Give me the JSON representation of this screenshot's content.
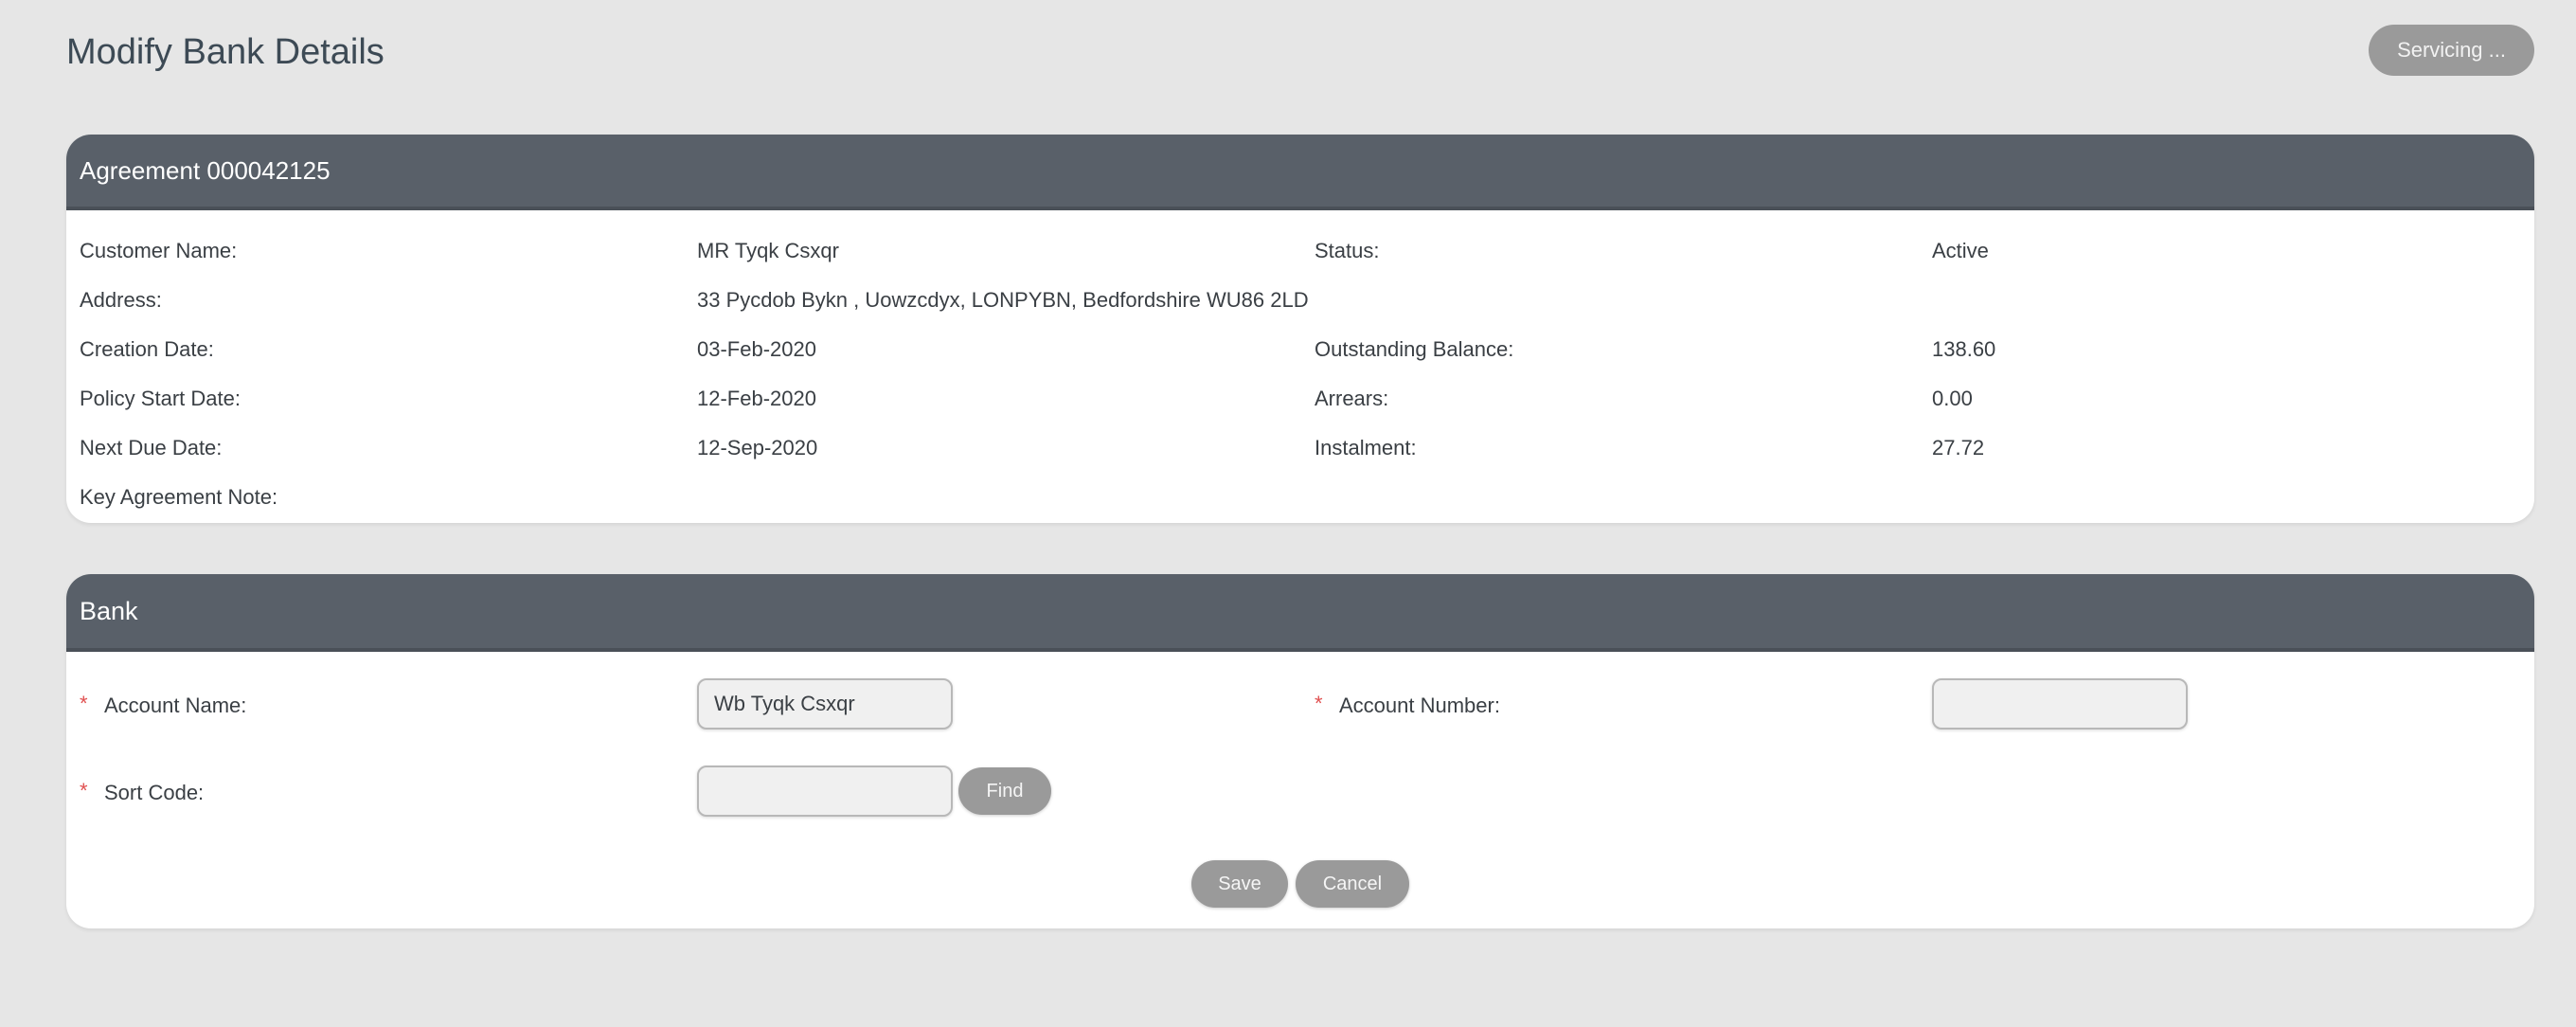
{
  "page": {
    "title": "Modify Bank Details",
    "servicing_label": "Servicing ..."
  },
  "agreement": {
    "header": "Agreement 000042125",
    "rows": [
      {
        "label1": "Customer Name:",
        "value1": "MR Tyqk Csxqr",
        "label2": "Status:",
        "value2": "Active"
      },
      {
        "label1": "Address:",
        "value1": "33 Pycdob Bykn , Uowzcdyx, LONPYBN, Bedfordshire WU86 2LD",
        "label2": "",
        "value2": ""
      },
      {
        "label1": "Creation Date:",
        "value1": "03-Feb-2020",
        "label2": "Outstanding Balance:",
        "value2": "138.60"
      },
      {
        "label1": "Policy Start Date:",
        "value1": "12-Feb-2020",
        "label2": "Arrears:",
        "value2": "0.00"
      },
      {
        "label1": "Next Due Date:",
        "value1": "12-Sep-2020",
        "label2": "Instalment:",
        "value2": "27.72"
      },
      {
        "label1": "Key Agreement Note:",
        "value1": "",
        "label2": "",
        "value2": ""
      }
    ]
  },
  "bank": {
    "header": "Bank",
    "required_marker": "*",
    "account_name_label": "Account Name:",
    "account_name_value": "Wb Tyqk Csxqr",
    "account_number_label": "Account Number:",
    "account_number_value": "",
    "sort_code_label": "Sort Code:",
    "sort_code_value": "",
    "find_label": "Find",
    "save_label": "Save",
    "cancel_label": "Cancel"
  },
  "colors": {
    "header_bg": "#596069",
    "button_bg": "#9a9a9a",
    "required": "#e05050",
    "page_bg": "#e6e6e6"
  }
}
